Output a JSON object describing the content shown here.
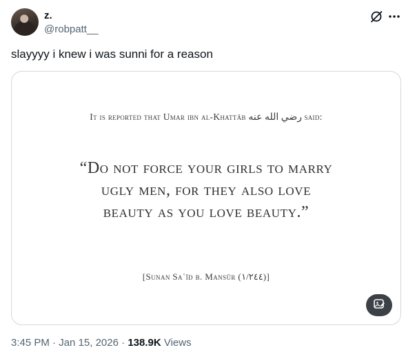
{
  "author": {
    "display_name": "z.",
    "handle": "@robpatt__"
  },
  "tweet": {
    "text": "slayyyy i knew i was sunni for a reason"
  },
  "media": {
    "attribution_prefix": "It is reported that Umar ibn al-Khattāb",
    "attribution_arabic": "رضي الله عنه",
    "attribution_suffix": "said:",
    "quote_line_1": "“Do not force your girls to marry",
    "quote_line_2": "ugly men, for they also love",
    "quote_line_3": "beauty as you love beauty.”",
    "source": "[Sunan Saʿīd b. Mansūr (١/٢٤٤)]",
    "alt_badge_icon": "image-description-icon"
  },
  "meta": {
    "time": "3:45 PM",
    "separator_1": " · ",
    "date": "Jan 15, 2026",
    "separator_2": " · ",
    "views_count": "138.9K",
    "views_label": " Views"
  },
  "icons": {
    "grok": "grok-icon",
    "more": "more-icon"
  },
  "colors": {
    "text_primary": "#0f1419",
    "text_secondary": "#536471",
    "border": "#cfd9de",
    "badge_bg": "#3b4146"
  }
}
